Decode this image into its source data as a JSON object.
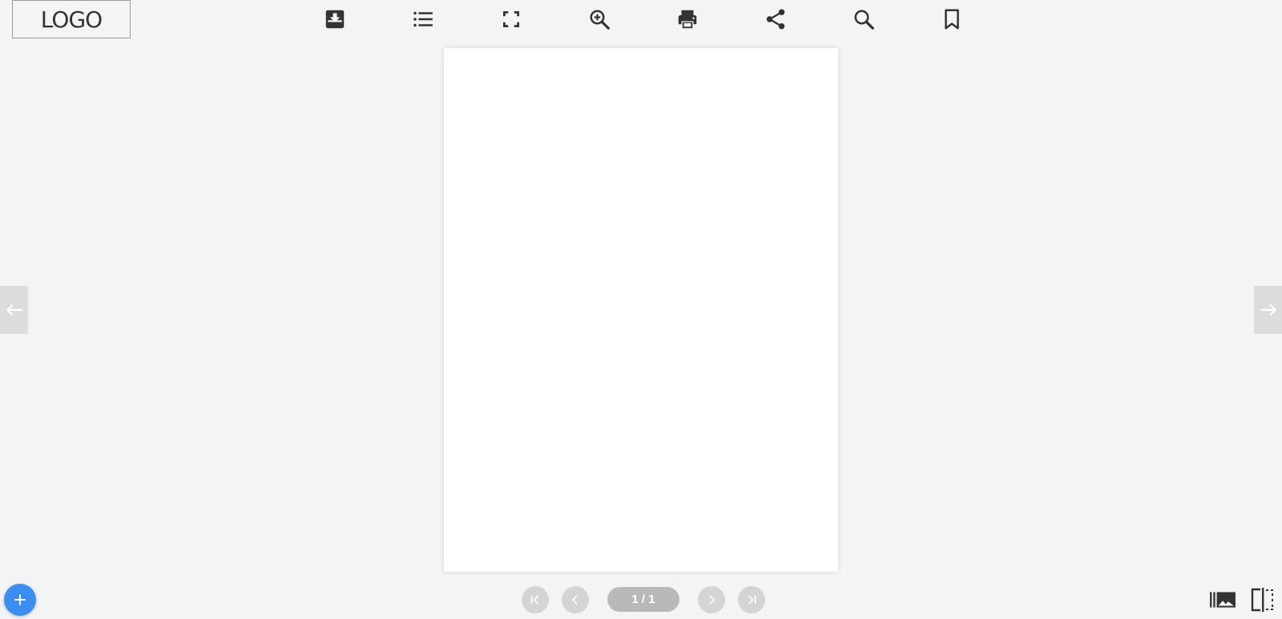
{
  "header": {
    "logo_text": "LOGO",
    "toolbar": [
      {
        "name": "download-button",
        "icon": "download-tray-icon"
      },
      {
        "name": "table-of-contents-button",
        "icon": "list-icon"
      },
      {
        "name": "fullscreen-button",
        "icon": "fullscreen-icon"
      },
      {
        "name": "zoom-in-button",
        "icon": "zoom-in-icon"
      },
      {
        "name": "print-button",
        "icon": "printer-icon"
      },
      {
        "name": "share-button",
        "icon": "share-icon"
      },
      {
        "name": "search-button",
        "icon": "search-icon"
      },
      {
        "name": "bookmark-button",
        "icon": "bookmark-icon"
      }
    ]
  },
  "navigation": {
    "prev_arrow_icon": "arrow-left-icon",
    "next_arrow_icon": "arrow-right-icon",
    "first_page_icon": "first-page-icon",
    "prev_page_icon": "chevron-left-icon",
    "next_page_icon": "chevron-right-icon",
    "last_page_icon": "last-page-icon",
    "page_indicator": "1 / 1"
  },
  "footer": {
    "add_icon": "plus-icon",
    "thumbnails_icon": "thumbnails-icon",
    "layout_icon": "split-view-icon"
  },
  "colors": {
    "background": "#f3f4f6",
    "icon": "#333333",
    "fab": "#3b8df0",
    "nav_button": "#d4d4d4",
    "page_indicator": "#b9b9b9"
  }
}
